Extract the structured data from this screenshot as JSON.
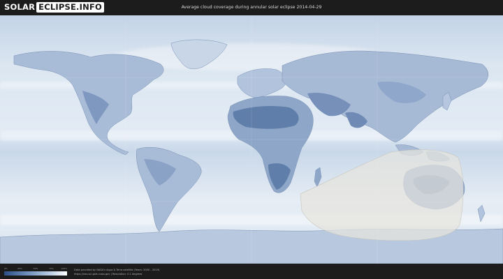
{
  "header": {
    "logo_left": "SOLAR",
    "logo_right": "ECLIPSE.INFO",
    "title": "Average cloud coverage during annular solar eclipse 2014-04-29"
  },
  "legend": {
    "ticks": [
      "0%",
      "25%",
      "50%",
      "75%",
      "100%"
    ],
    "tick_values": [
      0,
      25,
      50,
      75,
      100
    ],
    "colors": {
      "low": "#2d4f86",
      "high": "#ffffff"
    }
  },
  "footer": {
    "source_line1": "Data provided by NASA's Aqua & Terra satellite (Years: 2000 - 2019)",
    "source_line2": "https://neo.sci.gsfc.nasa.gov | Resolution: 0.1 degrees"
  },
  "map": {
    "ocean_color": "#cfdceb",
    "land_color": "#8ea6c8",
    "eclipse_path_color": "#e6e4de"
  }
}
